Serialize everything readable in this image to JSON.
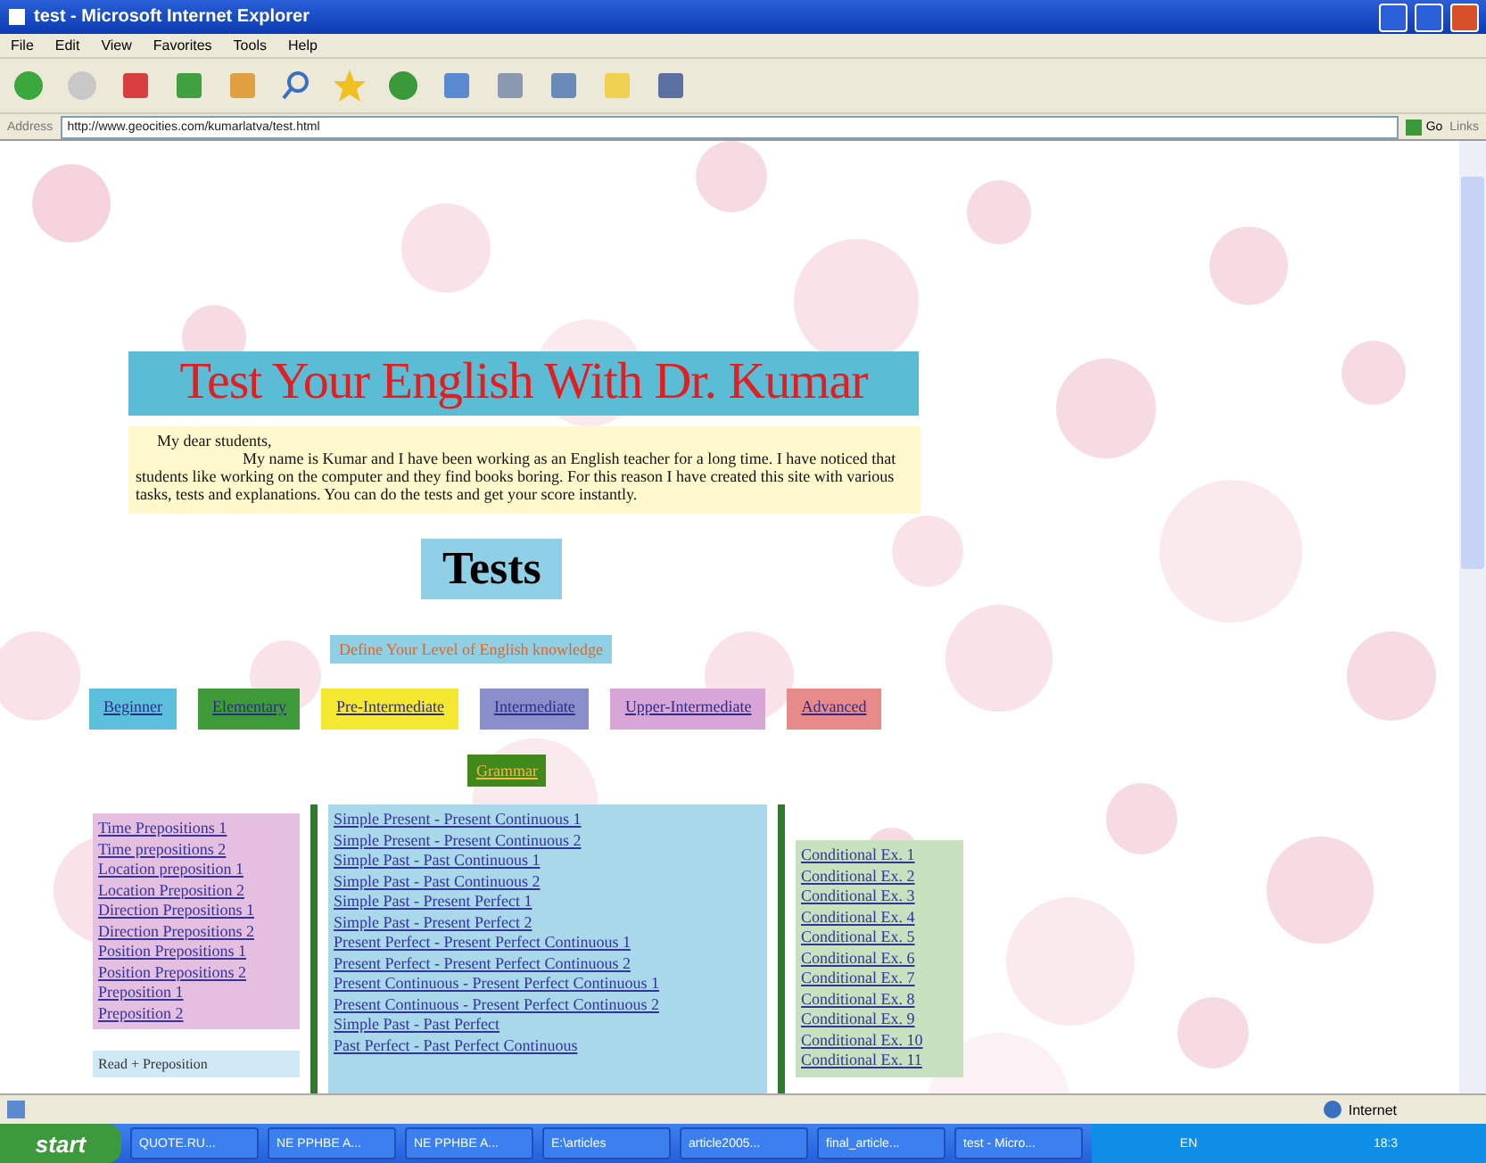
{
  "window": {
    "title": "test - Microsoft Internet Explorer"
  },
  "menu": [
    "File",
    "Edit",
    "View",
    "Favorites",
    "Tools",
    "Help"
  ],
  "address": {
    "label": "Address",
    "url": "http://www.geocities.com/kumarlatva/test.html",
    "go": "Go",
    "links": "Links"
  },
  "page": {
    "heading": "Test Your English With Dr. Kumar",
    "greeting": "My dear students,",
    "letter": "My name is Kumar and I have been working as an English teacher for a long time. I have noticed that students like working on the computer and they find books boring. For this reason I have created this site with various tasks, tests and explanations. You can do the tests and get your score instantly.",
    "tests_title": "Tests",
    "level_prompt": "Define Your Level of English knowledge",
    "levels": [
      {
        "label": "Beginner",
        "color": "#5cc0dc"
      },
      {
        "label": "Elementary",
        "color": "#3f9a3a"
      },
      {
        "label": "Pre-Intermediate",
        "color": "#f4e832"
      },
      {
        "label": "Intermediate",
        "color": "#8a8fcc"
      },
      {
        "label": "Upper-Intermediate",
        "color": "#d8a6d6"
      },
      {
        "label": "Advanced",
        "color": "#e98a8a"
      }
    ],
    "grammar": "Grammar",
    "prepositions": [
      "Time Prepositions 1",
      "Time prepositions 2",
      "Location preposition 1",
      "Location Preposition 2",
      "Direction Prepositions 1",
      "Direction Prepositions 2",
      "Position Prepositions 1",
      "Position Prepositions 2",
      "Preposition 1",
      "Preposition 2"
    ],
    "read_box": "Read + Preposition",
    "tenses": [
      "Simple Present - Present Continuous 1",
      "Simple Present - Present Continuous 2",
      "Simple Past - Past Continuous 1",
      "Simple Past - Past Continuous 2",
      "Simple Past - Present Perfect 1",
      "Simple Past - Present Perfect 2",
      "Present Perfect - Present Perfect Continuous 1",
      "Present Perfect - Present Perfect Continuous 2",
      "Present Continuous - Present Perfect Continuous 1",
      "Present Continuous - Present Perfect Continuous 2",
      "Simple Past - Past Perfect",
      "Past Perfect - Past Perfect Continuous"
    ],
    "conditionals": [
      "Conditional Ex. 1",
      "Conditional Ex. 2",
      "Conditional Ex. 3",
      "Conditional Ex. 4",
      "Conditional Ex. 5",
      "Conditional Ex. 6",
      "Conditional Ex. 7",
      "Conditional Ex. 8",
      "Conditional Ex. 9",
      "Conditional Ex. 10",
      "Conditional Ex. 11"
    ]
  },
  "status_bar": {
    "zone": "Internet"
  },
  "taskbar": {
    "start": "start",
    "tasks": [
      "QUOTE.RU...",
      "NE PPHBE A...",
      "NE PPHBE A...",
      "E:\\articles",
      "article2005...",
      "final_article...",
      "test - Micro..."
    ],
    "lang": "EN",
    "clock": "18:3"
  }
}
